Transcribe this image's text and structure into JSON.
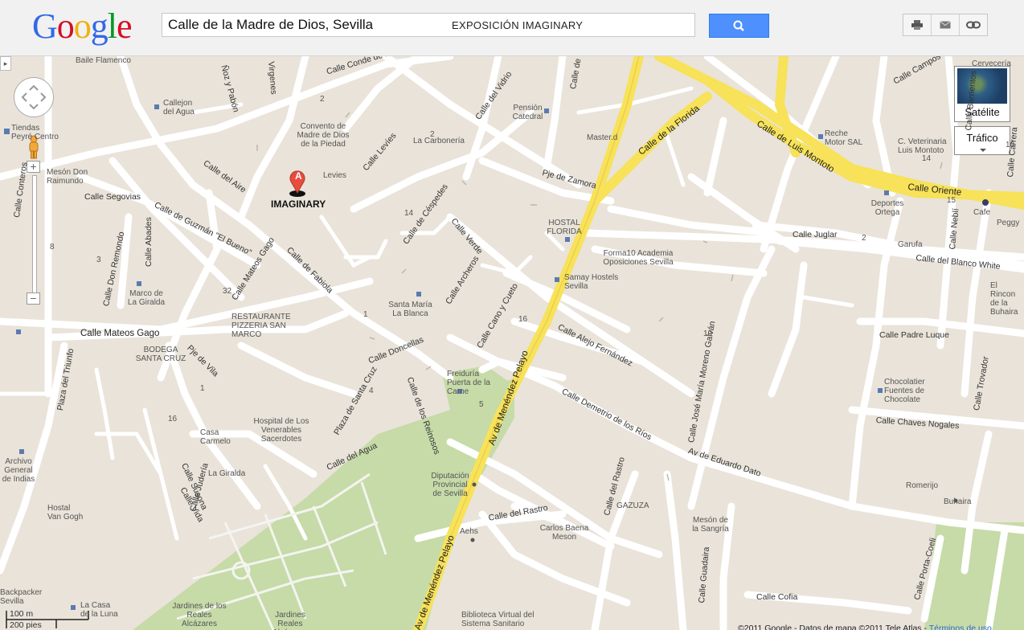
{
  "header": {
    "logo_text": "Google",
    "search_value": "Calle de la Madre de Dios, Sevilla",
    "search_banner": "EXPOSICIÓN IMAGINARY",
    "search_button_icon": "search-icon",
    "tools": [
      "print-icon",
      "email-icon",
      "link-icon"
    ]
  },
  "map": {
    "marker": {
      "letter": "A",
      "label": "IMAGINARY"
    },
    "layers": {
      "satellite": "Satélite",
      "traffic": "Tráfico"
    },
    "scale": {
      "metric": "100 m",
      "imperial": "200 pies"
    },
    "footer": {
      "copyright": "©2011 Google - Datos de mapa ©2011 Tele Atlas -",
      "terms": "Términos de uso"
    },
    "streets": {
      "conde_ibarra": "Calle Conde de Ibarra",
      "del_vidrio": "Calle del Vidrio",
      "levies": "Calle Levíes",
      "del_aire": "Calle del Aire",
      "segovias": "Calle Segovias",
      "guzman": "Calle de Guzmán \"El Bueno\"",
      "mateos_gago_v": "Calle Mateos Gago",
      "mateos_gago_h": "Calle Mateos Gago",
      "fabiola": "Calle de Fabiola",
      "cespedes": "Calle de Céspedes",
      "verde": "Calle Verde",
      "archeros": "Calle Archeros",
      "zamora": "Pje de Zamora",
      "florida": "Calle de la Florida",
      "luis_montoto": "Calle de Luis Montoto",
      "oriente": "Calle Oriente",
      "juglar": "Calle Juglar",
      "blanco_white": "Calle del Blanco White",
      "padre_luque": "Calle Padre Luque",
      "chaves_nogales": "Calle Chaves Nogales",
      "cano_cueto": "Calle Cano y Cueto",
      "alejo": "Calle Alejo Fernández",
      "demetrio": "Calle Demetrio de los Ríos",
      "eduardo_dato": "Av de Eduardo Dato",
      "jose_maria": "Calle José María Moreno Galván",
      "menendez_pelayo_1": "Av de Menéndez Pelayo",
      "menendez_pelayo_2": "Av de Menéndez Pelayo",
      "doncellas": "Calle Doncellas",
      "reinoso": "Calle de los Reinosos",
      "pje_vila": "Pje de Vila",
      "santa_cruz": "Plaza de Santa Cruz",
      "del_agua": "Calle del Agua",
      "abades": "Calle Abades",
      "don_remondo": "Calle Don Remondo",
      "conteros": "Calle Conteros",
      "del_rastro_v": "Calle del Rastro",
      "del_rastro_h": "Calle del Rastro",
      "guadaira": "Calle Guadaira",
      "cofia": "Calle Cofia",
      "porta_coeli": "Calle Porta-Coeli",
      "trovador": "Calle Trovador",
      "nebli": "Calle Neblí",
      "susona": "Calle Susona",
      "vida": "Calle Vida",
      "juderia": "Calle Judería",
      "triunfo": "Plaza del Triunfo",
      "pavon": "Ñoz y Pabón",
      "virgenes": "Virgenes",
      "de_la_o": "Calle de la O",
      "campos": "Calle Campos",
      "barrientos": "Calle Barrientos",
      "carrera": "Calle Carrera"
    },
    "pois": [
      "Baile Flamenco",
      "Callejon del Agua",
      "Tiendas Peyré Centro",
      "Mesón Don Raimundo",
      "Convento de Madre de Dios de la Piedad",
      "Levies",
      "La Carbonería",
      "Pensión Catedral",
      "Master.d",
      "Reche Motor SAL",
      "C. Veterinaria Luis Montoto",
      "Cervecería",
      "Deportes Ortega",
      "Cafe",
      "Peggy",
      "Garufa",
      "HOSTAL FLORIDA",
      "Forma10 Academia Oposiciones Sevilla",
      "Samay Hostels Sevilla",
      "El Rincon de la Buhaira",
      "Marco de La Giralda",
      "RESTAURANTE PIZZERIA SAN MARCO",
      "BODEGA SANTA CRUZ",
      "Santa María La Blanca",
      "Freiduría Puerta de la Carne",
      "Chocolatier Fuentes de Chocolate",
      "Casa Carmelo",
      "Hospital de Los Venerables Sacerdotes",
      "La Giralda",
      "Diputación Provincial de Sevilla",
      "GAZUZA",
      "Romerijo",
      "Buhaira",
      "Carlos Baena Meson",
      "Mesón de la Sangría",
      "Aehs",
      "Archivo General de Indias",
      "Hostal Van Gogh",
      "Jardines Reales Alcázares",
      "Jardines de los Reales Alcázares",
      "Biblioteca Virtual del Sistema Sanitario",
      "La Casa de la Luna",
      "Backpacker Sevilla"
    ],
    "numbers": [
      "2",
      "2",
      "14",
      "8",
      "32",
      "1",
      "4",
      "16",
      "5",
      "10",
      "2",
      "15",
      "14",
      "10",
      "3",
      "1",
      "16"
    ]
  }
}
